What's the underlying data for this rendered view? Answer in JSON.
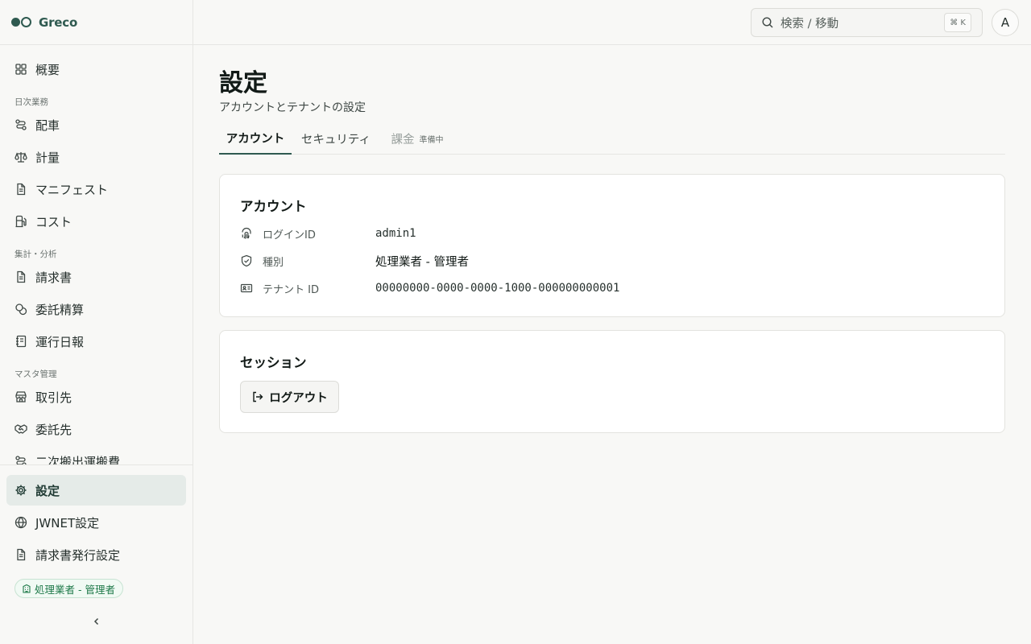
{
  "brand": {
    "name": "Greco"
  },
  "sidebar": {
    "overview": {
      "label": "概要",
      "icon": "dashboard-icon"
    },
    "sections": {
      "daily": "日次業務",
      "analysis": "集計・分析",
      "master": "マスタ管理"
    },
    "daily_items": [
      {
        "label": "配車",
        "icon": "route-icon"
      },
      {
        "label": "計量",
        "icon": "scale-icon"
      },
      {
        "label": "マニフェスト",
        "icon": "document-icon"
      },
      {
        "label": "コスト",
        "icon": "fuel-icon"
      }
    ],
    "analysis_items": [
      {
        "label": "請求書",
        "icon": "document-icon"
      },
      {
        "label": "委託精算",
        "icon": "coins-icon"
      },
      {
        "label": "運行日報",
        "icon": "notebook-icon"
      }
    ],
    "master_items": [
      {
        "label": "取引先",
        "icon": "store-icon"
      },
      {
        "label": "委託先",
        "icon": "handshake-icon"
      },
      {
        "label": "二次搬出運搬費",
        "icon": "route-icon"
      }
    ],
    "bottom_items": [
      {
        "label": "設定",
        "icon": "gear-icon",
        "active": true
      },
      {
        "label": "JWNET設定",
        "icon": "globe-icon"
      },
      {
        "label": "請求書発行設定",
        "icon": "document-icon"
      }
    ],
    "role_badge": "処理業者 - 管理者"
  },
  "topbar": {
    "search_placeholder": "検索 / 移動",
    "shortcut": "⌘ K",
    "avatar_initial": "A"
  },
  "page": {
    "title": "設定",
    "subtitle": "アカウントとテナントの設定",
    "tabs": [
      {
        "label": "アカウント",
        "active": true
      },
      {
        "label": "セキュリティ"
      },
      {
        "label": "課金",
        "sub": "準備中",
        "disabled": true
      }
    ]
  },
  "account_card": {
    "title": "アカウント",
    "rows": [
      {
        "label": "ログインID",
        "value": "admin1",
        "icon": "fingerprint-icon"
      },
      {
        "label": "種別",
        "value": "処理業者 - 管理者",
        "icon": "shield-check-icon"
      },
      {
        "label": "テナント ID",
        "value": "00000000-0000-0000-1000-000000000001",
        "icon": "id-card-icon"
      }
    ]
  },
  "session_card": {
    "title": "セッション",
    "logout_label": "ログアウト"
  },
  "colors": {
    "accent": "#2f5a50",
    "active_bg": "#e5ebe8",
    "badge_green": "#1f7a4a"
  }
}
